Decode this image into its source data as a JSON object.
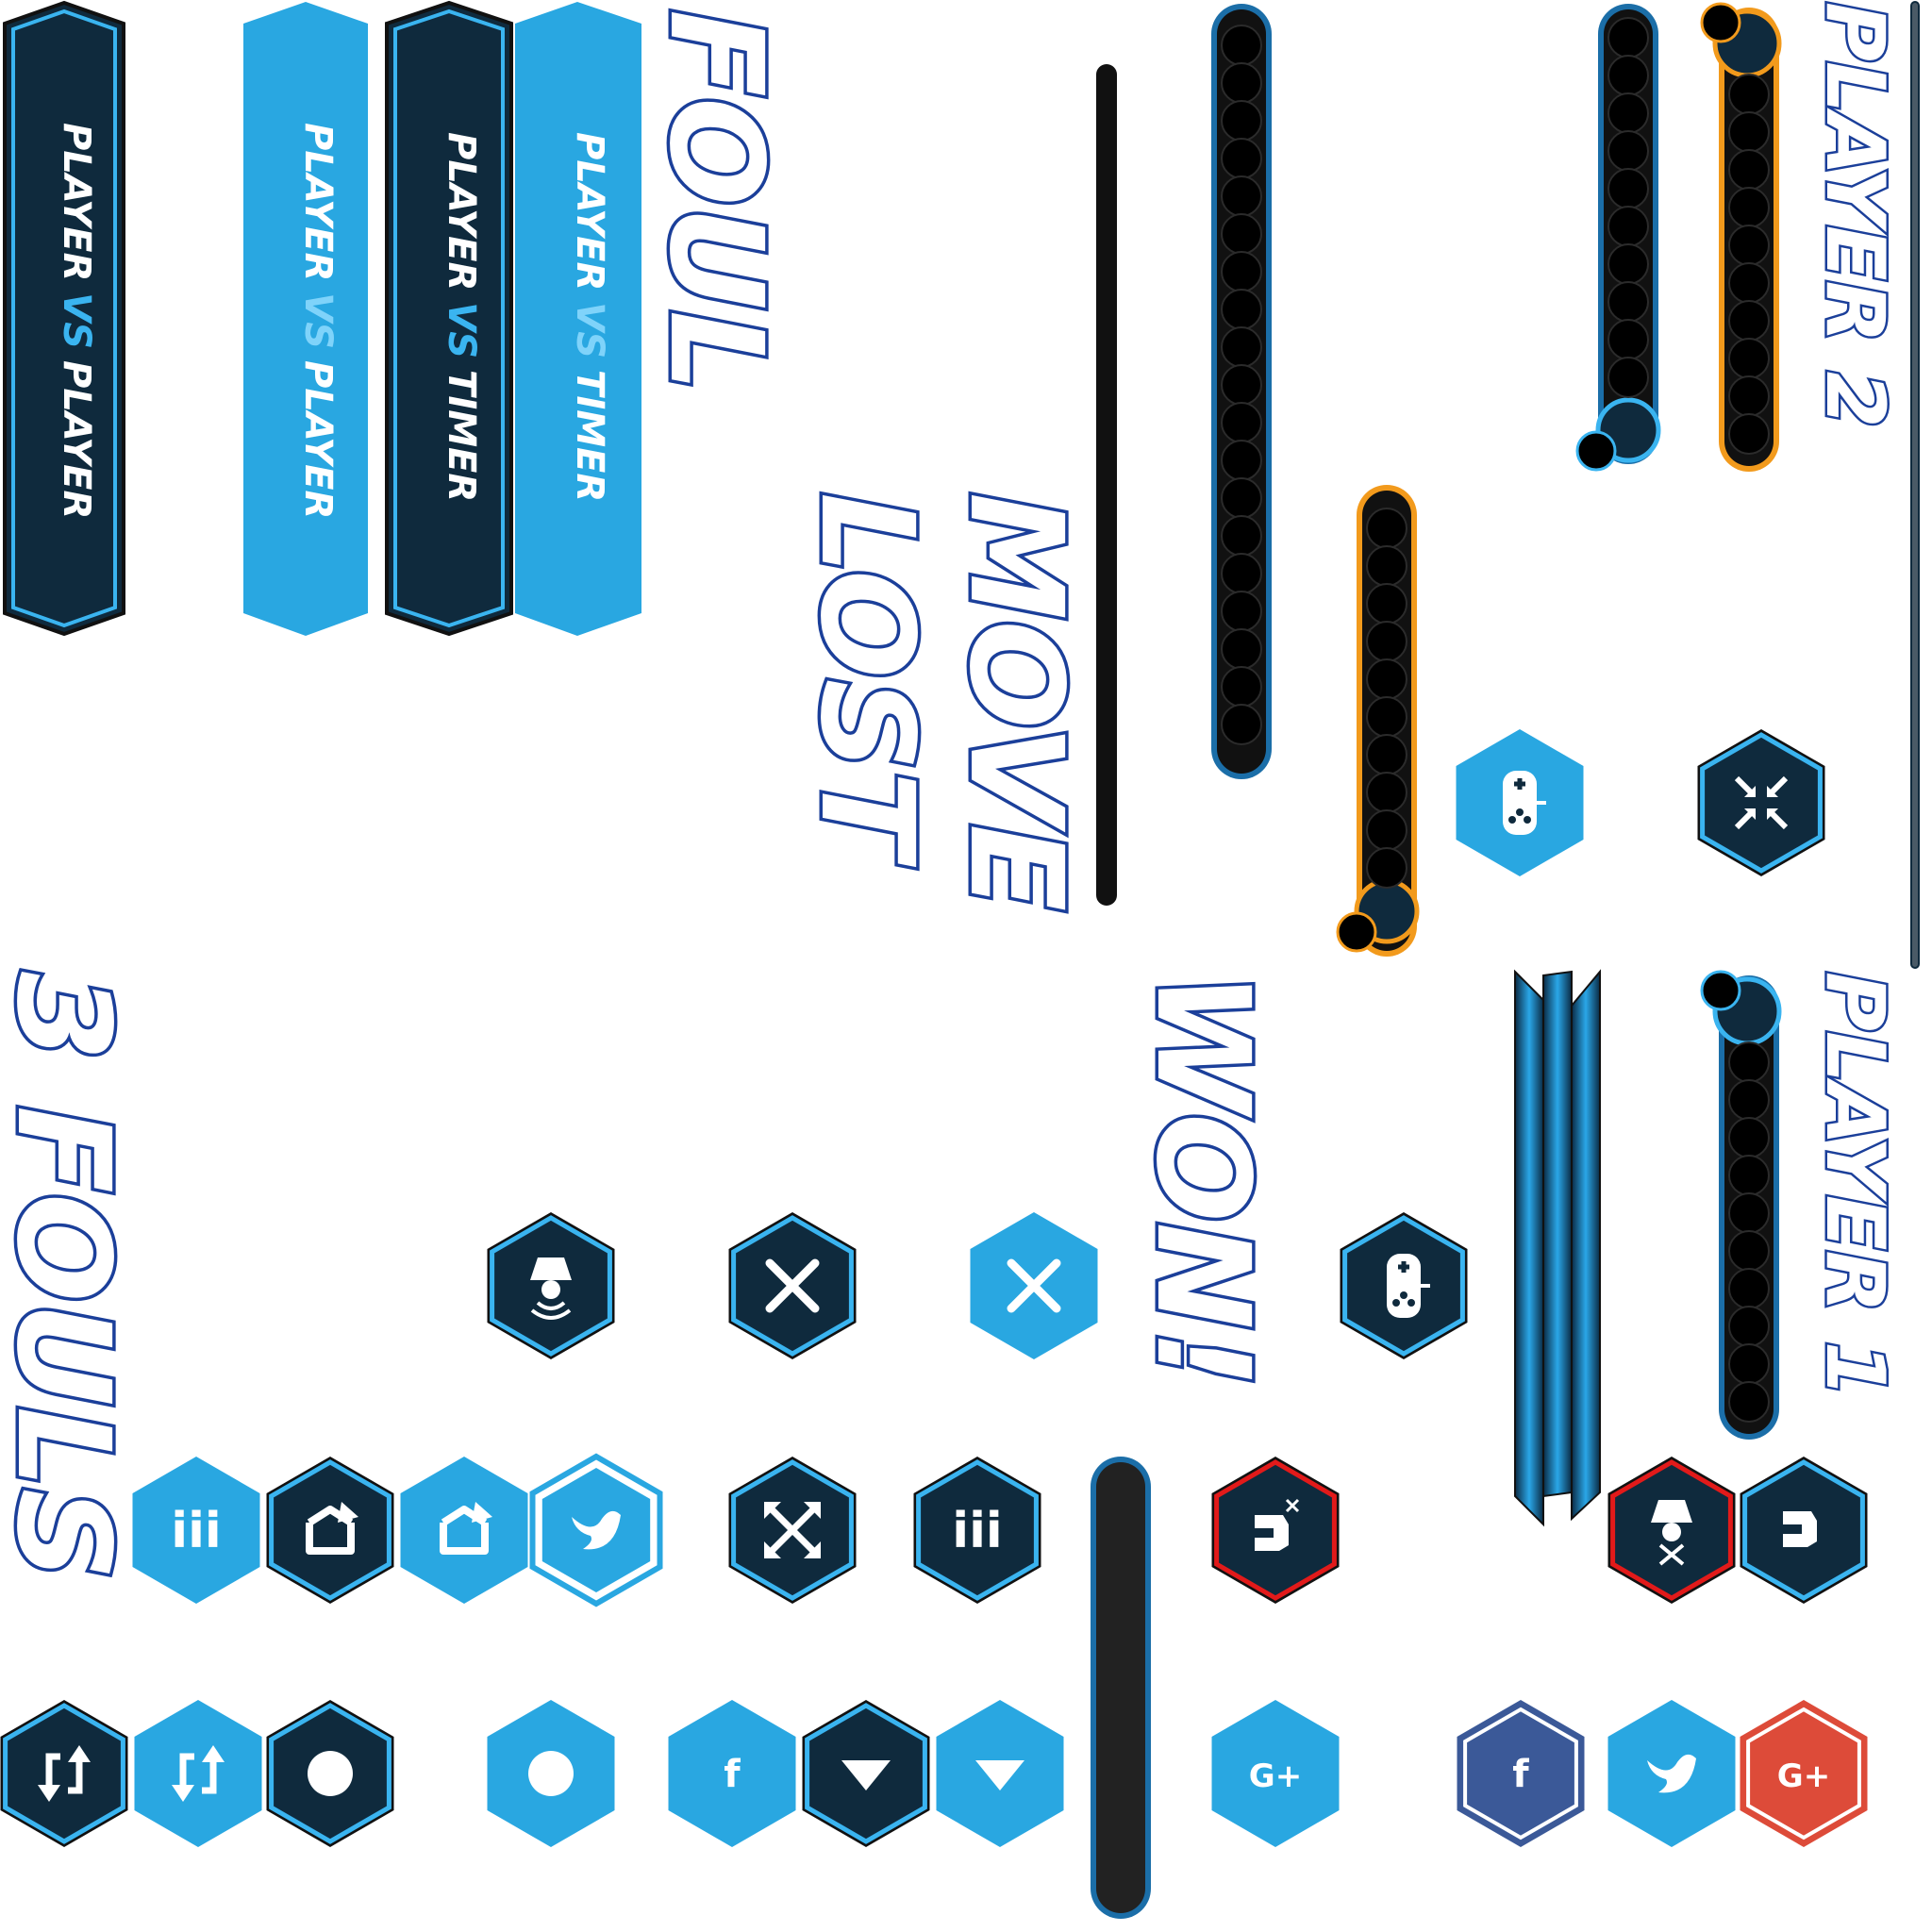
{
  "colors": {
    "navy": "#0f2a3d",
    "sky": "#29a7e1",
    "glow": "#3ab4f0",
    "outline": "#1b3f9a",
    "orange": "#f29a1c",
    "red": "#e21a1a",
    "facebook": "#3b5998",
    "googleplus": "#dd4b39",
    "white": "#ffffff"
  },
  "mode_banners": [
    {
      "name": "pvp-dark",
      "line1": "PLAYER",
      "vs": "VS",
      "line2": "PLAYER"
    },
    {
      "name": "pvp-light",
      "line1": "PLAYER",
      "vs": "VS",
      "line2": "PLAYER"
    },
    {
      "name": "pvt-dark",
      "line1": "PLAYER",
      "vs": "VS",
      "line2": "TIMER"
    },
    {
      "name": "pvt-light",
      "line1": "PLAYER",
      "vs": "VS",
      "line2": "TIMER"
    }
  ],
  "labels": {
    "foul": "FOUL",
    "move": "MOVE",
    "lost": "LOST",
    "won": "WON!",
    "three_fouls": "3 FOULS",
    "player2": "PLAYER 2",
    "player1": "PLAYER 1"
  },
  "icons": {
    "pause": "iii",
    "facebook": "f",
    "googleplus": "G+"
  }
}
